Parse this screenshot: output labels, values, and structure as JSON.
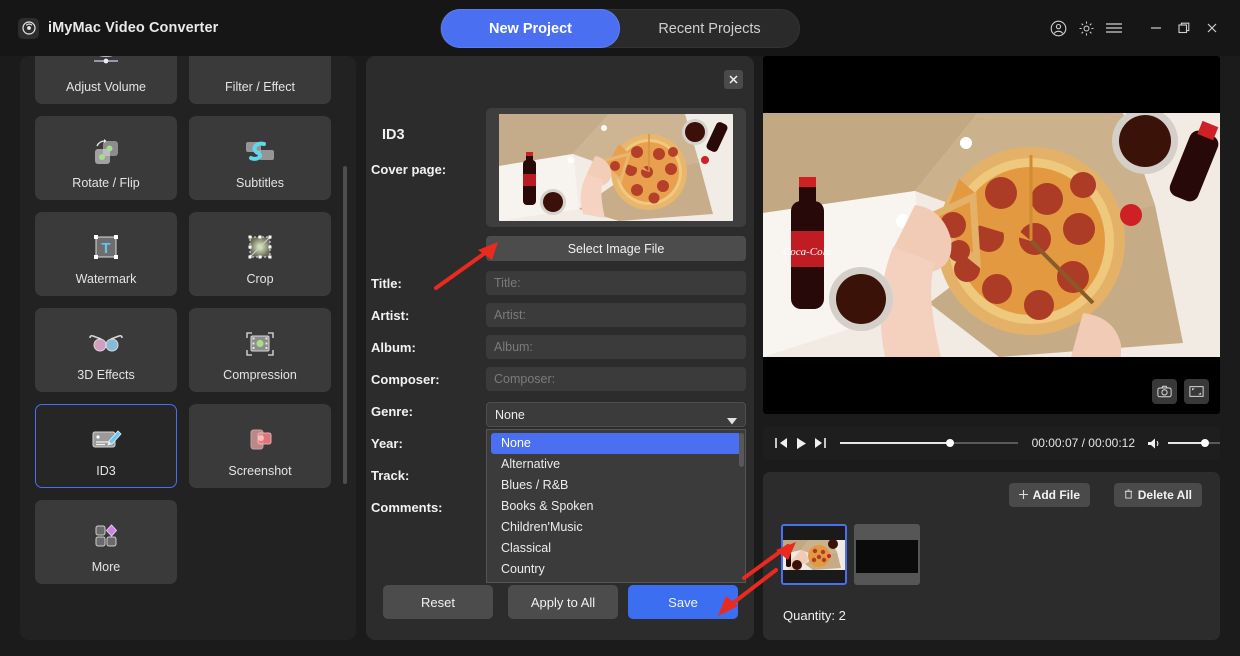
{
  "app": {
    "title": "iMyMac Video Converter",
    "logo_icon": "disc-logo-icon"
  },
  "header": {
    "tabs": [
      {
        "label": "New Project",
        "active": true
      },
      {
        "label": "Recent Projects",
        "active": false
      }
    ],
    "window_icons": [
      {
        "name": "account-icon"
      },
      {
        "name": "gear-icon"
      },
      {
        "name": "hamburger-menu-icon"
      },
      {
        "name": "minimize-icon"
      },
      {
        "name": "maximize-icon"
      },
      {
        "name": "close-icon"
      }
    ]
  },
  "tools": {
    "items": [
      {
        "label": "Adjust Volume",
        "icon": "volume-slider-icon",
        "selected": false
      },
      {
        "label": "Filter / Effect",
        "icon": "filter-sphere-icon",
        "selected": false
      },
      {
        "label": "Rotate / Flip",
        "icon": "rotate-flip-icon",
        "selected": false
      },
      {
        "label": "Subtitles",
        "icon": "subtitles-bubble-icon",
        "selected": false
      },
      {
        "label": "Watermark",
        "icon": "watermark-text-icon",
        "selected": false
      },
      {
        "label": "Crop",
        "icon": "crop-frame-icon",
        "selected": false
      },
      {
        "label": "3D Effects",
        "icon": "3d-glasses-icon",
        "selected": false
      },
      {
        "label": "Compression",
        "icon": "compression-film-icon",
        "selected": false
      },
      {
        "label": "ID3",
        "icon": "id3-tag-edit-icon",
        "selected": true
      },
      {
        "label": "Screenshot",
        "icon": "screenshot-phone-icon",
        "selected": false
      },
      {
        "label": "More",
        "icon": "more-squares-icon",
        "selected": false
      }
    ]
  },
  "id3": {
    "panel_title": "ID3",
    "close_icon": "close-icon",
    "cover_label": "Cover page:",
    "select_image_label": "Select Image File",
    "fields": [
      {
        "label": "Title:",
        "placeholder": "Title:",
        "value": ""
      },
      {
        "label": "Artist:",
        "placeholder": "Artist:",
        "value": ""
      },
      {
        "label": "Album:",
        "placeholder": "Album:",
        "value": ""
      },
      {
        "label": "Composer:",
        "placeholder": "Composer:",
        "value": ""
      }
    ],
    "genre": {
      "label": "Genre:",
      "selected": "None",
      "caret_icon": "chevron-down-icon",
      "options": [
        "None",
        "Alternative",
        "Blues / R&B",
        "Books & Spoken",
        "Children'Music",
        "Classical",
        "Country"
      ]
    },
    "year_label": "Year:",
    "track_label": "Track:",
    "comments_label": "Comments:",
    "buttons": {
      "reset": "Reset",
      "apply_to_all": "Apply to All",
      "save": "Save"
    }
  },
  "preview": {
    "snapshot_icon": "camera-icon",
    "fullscreen_icon": "fullscreen-icon",
    "controls": {
      "prev_icon": "previous-frame-icon",
      "play_icon": "play-icon",
      "next_icon": "next-frame-icon",
      "time": "00:00:07 / 00:00:12",
      "volume_icon": "volume-icon",
      "seek_percent": 60,
      "volume_percent": 72
    }
  },
  "filelist": {
    "add_file_label": "Add File",
    "add_file_icon": "plus-icon",
    "delete_all_label": "Delete All",
    "delete_all_icon": "trash-icon",
    "quantity_label": "Quantity: 2",
    "thumbnails": [
      {
        "name": "pizza-clip-thumbnail",
        "selected": true
      },
      {
        "name": "dark-clip-thumbnail",
        "selected": false
      }
    ]
  },
  "colors": {
    "accent": "#4a6ff0",
    "save_button": "#3b6ef0",
    "window_bg": "#1b1b1b",
    "panel_bg": "#2c2c2c",
    "tool_bg": "#3a3a3a",
    "annotation_arrow": "#ea2a1f"
  }
}
